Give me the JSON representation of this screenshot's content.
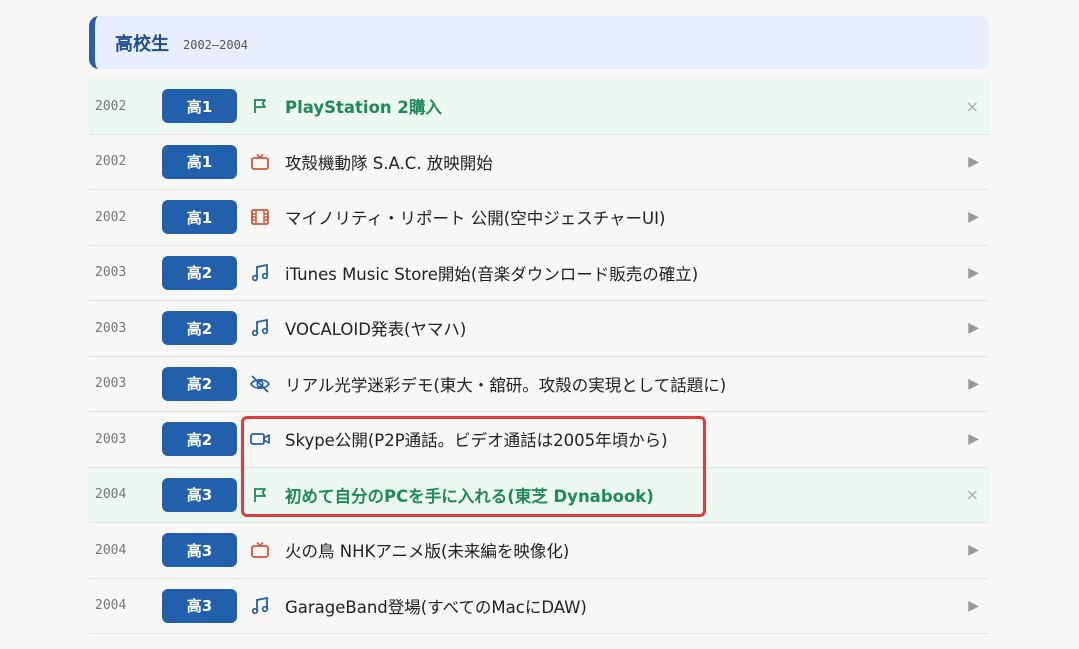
{
  "section": {
    "title": "高校生",
    "range": "2002–2004"
  },
  "rows": [
    {
      "year": "2002",
      "grade": "高1",
      "icon": "flag-icon",
      "label": "PlayStation 2購入",
      "highlight": true,
      "action": "×"
    },
    {
      "year": "2002",
      "grade": "高1",
      "icon": "tv-icon",
      "label": "攻殻機動隊 S.A.C. 放映開始",
      "highlight": false,
      "action": "▶"
    },
    {
      "year": "2002",
      "grade": "高1",
      "icon": "film-icon",
      "label": "マイノリティ・リポート 公開(空中ジェスチャーUI)",
      "highlight": false,
      "action": "▶"
    },
    {
      "year": "2003",
      "grade": "高2",
      "icon": "music-icon",
      "label": "iTunes Music Store開始(音楽ダウンロード販売の確立)",
      "highlight": false,
      "action": "▶"
    },
    {
      "year": "2003",
      "grade": "高2",
      "icon": "music-icon",
      "label": "VOCALOID発表(ヤマハ)",
      "highlight": false,
      "action": "▶"
    },
    {
      "year": "2003",
      "grade": "高2",
      "icon": "eye-off-icon",
      "label": "リアル光学迷彩デモ(東大・舘研。攻殻の実現として話題に)",
      "highlight": false,
      "action": "▶"
    },
    {
      "year": "2003",
      "grade": "高2",
      "icon": "video-icon",
      "label": "Skype公開(P2P通話。ビデオ通話は2005年頃から)",
      "highlight": false,
      "action": "▶"
    },
    {
      "year": "2004",
      "grade": "高3",
      "icon": "flag-icon",
      "label": "初めて自分のPCを手に入れる(東芝 Dynabook)",
      "highlight": true,
      "action": "×"
    },
    {
      "year": "2004",
      "grade": "高3",
      "icon": "tv-icon",
      "label": "火の鳥 NHKアニメ版(未来編を映像化)",
      "highlight": false,
      "action": "▶"
    },
    {
      "year": "2004",
      "grade": "高3",
      "icon": "music-icon",
      "label": "GarageBand登場(すべてのMacにDAW)",
      "highlight": false,
      "action": "▶"
    }
  ],
  "colors": {
    "accent": "#2360ac",
    "highlight_text": "#1e8a5a",
    "tv": "#d2553a",
    "annotation": "#e03c3c"
  }
}
